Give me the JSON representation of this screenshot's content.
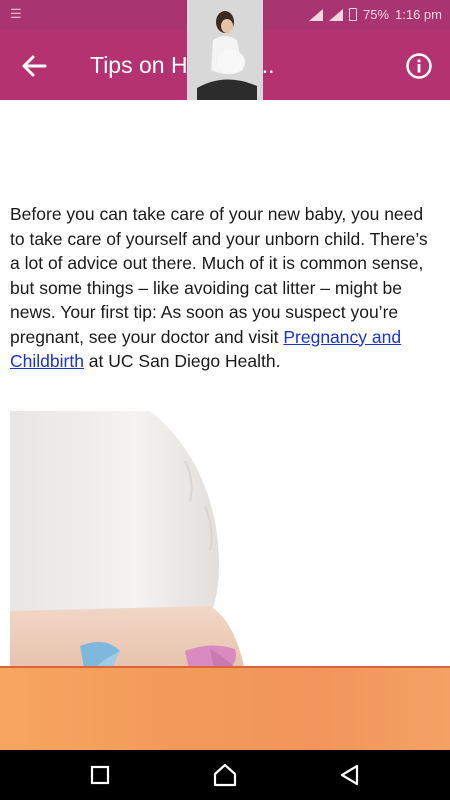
{
  "status_bar": {
    "battery": "75%",
    "time": "1:16 pm"
  },
  "app_bar": {
    "title": "Tips on Healthy ...",
    "back_icon": "arrow-back-icon",
    "info_icon": "info-icon"
  },
  "article": {
    "intro_before_link": "Before you can take care of your new baby, you need to take care of yourself and your unborn child. There’s a lot of advice out there. Much of it is common sense, but some things – like avoiding cat litter – might be news. Your first tip: As soon as you suspect you’re pregnant, see your doctor and visit ",
    "link_text": "Pregnancy and Childbirth",
    "intro_after_link": " at UC San Diego Health."
  },
  "nav": {
    "recents_icon": "square-recents-icon",
    "home_icon": "home-icon",
    "back_icon": "triangle-back-icon"
  },
  "colors": {
    "app_bar": "#b3326f",
    "status_bar": "#a8356f",
    "link": "#1a33cc",
    "ad_banner": "#f39a5a"
  }
}
